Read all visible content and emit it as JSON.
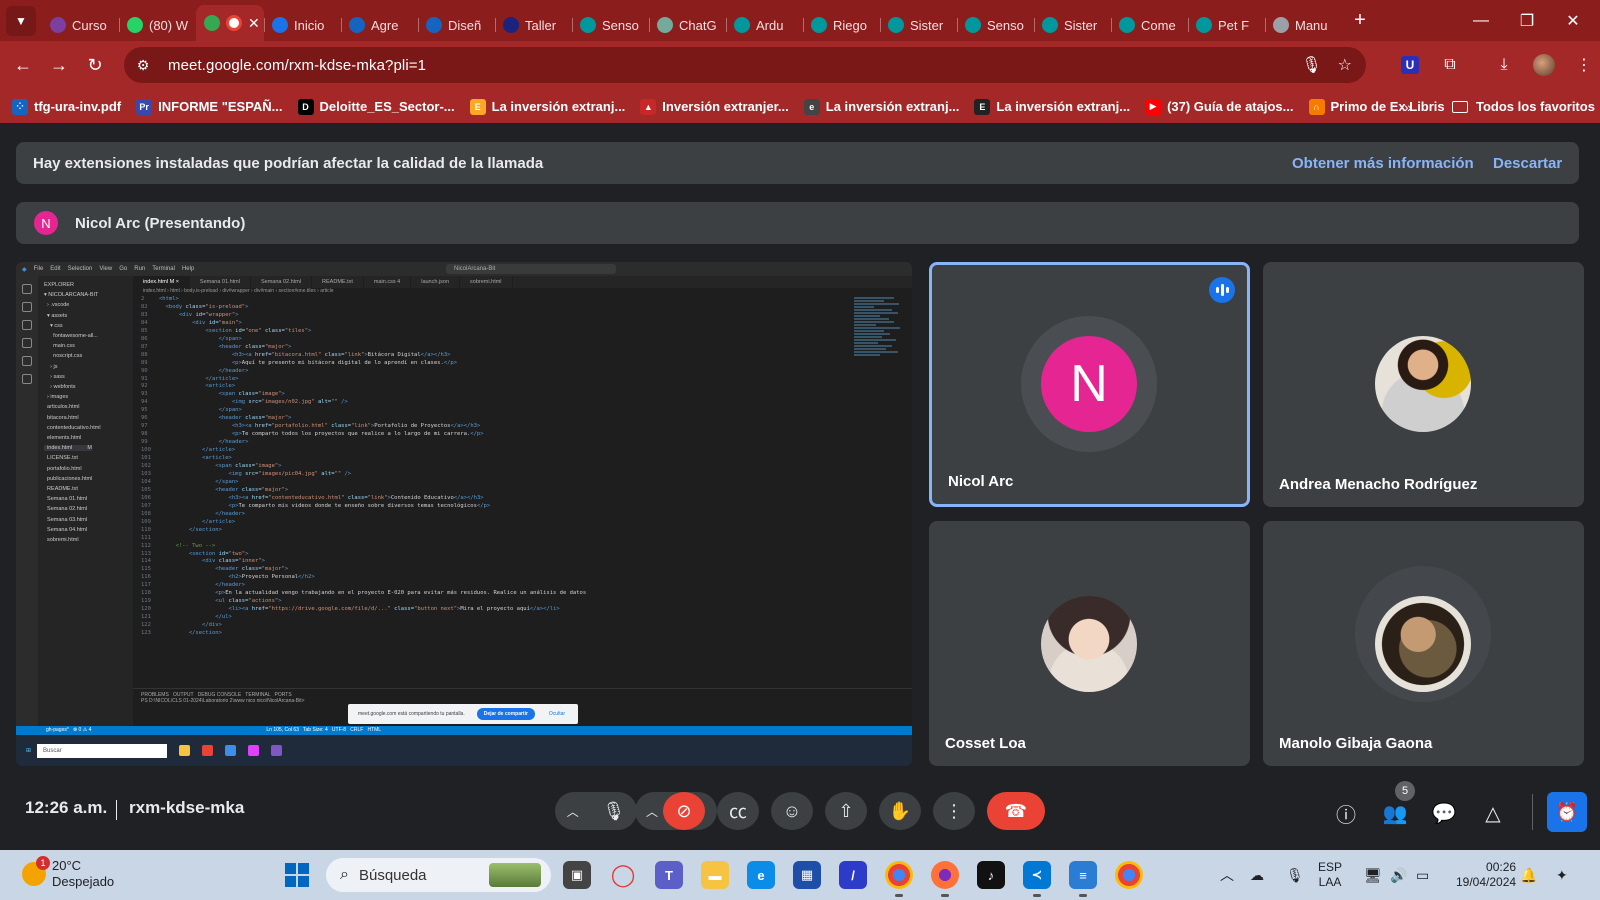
{
  "browser": {
    "tabs": [
      {
        "label": "Curso",
        "icon": "cursor-favicon-icon",
        "color": "#7b3fa0"
      },
      {
        "label": "(80) W",
        "icon": "whatsapp-icon",
        "color": "#25d366"
      },
      {
        "label": "",
        "icon": "meet-recording-icon",
        "color": "#34a853",
        "active": true
      },
      {
        "label": "Inicio",
        "icon": "edge-favicon-icon",
        "color": "#1a73e8"
      },
      {
        "label": "Agre",
        "icon": "shield-favicon-icon",
        "color": "#1565c0"
      },
      {
        "label": "Diseñ",
        "icon": "shield-favicon-icon",
        "color": "#1565c0"
      },
      {
        "label": "Taller",
        "icon": "video-favicon-icon",
        "color": "#1a237e"
      },
      {
        "label": "Senso",
        "icon": "arduino-icon",
        "color": "#00979d"
      },
      {
        "label": "ChatG",
        "icon": "chatgpt-icon",
        "color": "#74aa9c"
      },
      {
        "label": "Ardu",
        "icon": "arduino-icon",
        "color": "#00979d"
      },
      {
        "label": "Riego",
        "icon": "arduino-icon",
        "color": "#00979d"
      },
      {
        "label": "Sister",
        "icon": "arduino-icon",
        "color": "#00979d"
      },
      {
        "label": "Senso",
        "icon": "arduino-icon",
        "color": "#00979d"
      },
      {
        "label": "Sister",
        "icon": "arduino-icon",
        "color": "#00979d"
      },
      {
        "label": "Come",
        "icon": "arduino-icon",
        "color": "#00979d"
      },
      {
        "label": "Pet F",
        "icon": "arduino-icon",
        "color": "#00979d"
      },
      {
        "label": "Manu",
        "icon": "globe-icon",
        "color": "#9aa0a6"
      }
    ],
    "url": "meet.google.com/rxm-kdse-mka?pli=1",
    "bookmarks": [
      {
        "label": "tfg-ura-inv.pdf",
        "color": "#1565c0",
        "glyph": "⁘"
      },
      {
        "label": "INFORME \"ESPAÑ...",
        "color": "#3949ab",
        "glyph": "Pr"
      },
      {
        "label": "Deloitte_ES_Sector-...",
        "color": "#000000",
        "glyph": "D"
      },
      {
        "label": "La inversión extranj...",
        "color": "#f9a825",
        "glyph": "E"
      },
      {
        "label": "Inversión extranjer...",
        "color": "#c62828",
        "glyph": "▲"
      },
      {
        "label": "La inversión extranj...",
        "color": "#444444",
        "glyph": "e"
      },
      {
        "label": "La inversión extranj...",
        "color": "#222222",
        "glyph": "E"
      },
      {
        "label": "(37) Guía de atajos...",
        "color": "#ff0000",
        "glyph": "▶"
      },
      {
        "label": "Primo de Ex Libris",
        "color": "#f57c00",
        "glyph": "∩"
      }
    ],
    "all_bookmarks": "Todos los favoritos"
  },
  "meet": {
    "banner": {
      "text": "Hay extensiones instaladas que podrían afectar la calidad de la llamada",
      "more_info": "Obtener más información",
      "dismiss": "Descartar"
    },
    "presenter": {
      "initial": "N",
      "label": "Nicol Arc (Presentando)"
    },
    "shared_screen": {
      "share_notice": "meet.google.com está compartiendo tu pantalla.",
      "stop_share": "Dejar de compartir",
      "hide": "Ocultar",
      "search_placeholder": "Buscar",
      "window_search": "NicolArcana-Bit"
    },
    "participants": [
      {
        "name": "Nicol Arc",
        "initial": "N",
        "speaking": true
      },
      {
        "name": "Andrea Menacho Rodríguez"
      },
      {
        "name": "Cosset Loa"
      },
      {
        "name": "Manolo Gibaja Gaona"
      }
    ],
    "bottom": {
      "time": "12:26 a.m.",
      "meeting_code": "rxm-kdse-mka",
      "people_count": "5"
    }
  },
  "taskbar": {
    "temperature": "20°C",
    "weather": "Despejado",
    "weather_badge": "1",
    "search_label": "Búsqueda",
    "language": "ESP",
    "layout": "LAA",
    "time": "00:26",
    "date": "19/04/2024"
  }
}
